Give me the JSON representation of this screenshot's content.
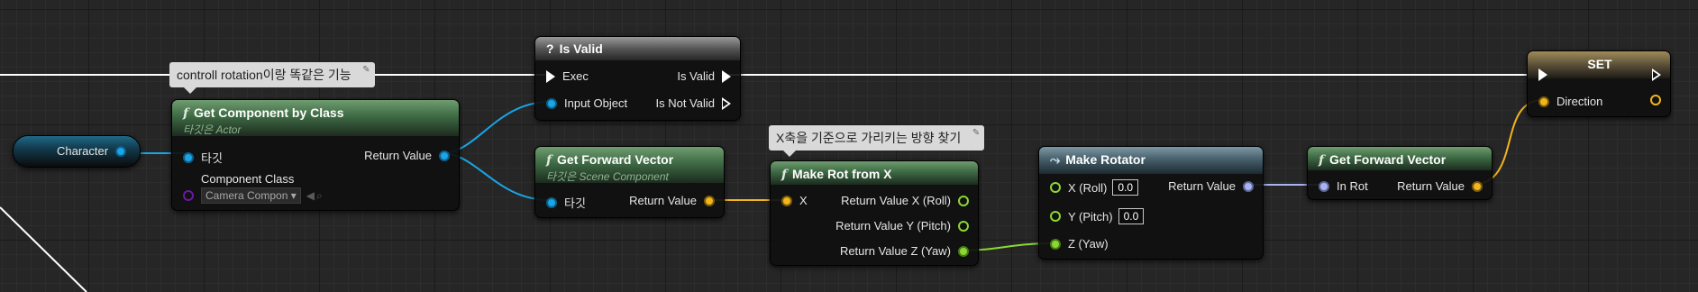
{
  "comments": {
    "c1": "controll rotation이랑 똑같은 기능",
    "c2": "X축을 기준으로 가리키는 방향 찾기"
  },
  "nodes": {
    "character_var": {
      "label": "Character"
    },
    "get_component": {
      "title": "Get Component by Class",
      "subtitle": "타깃은 Actor",
      "target_label": "타깃",
      "return_label": "Return Value",
      "class_label": "Component Class",
      "class_value": "Camera Compon",
      "dropdown_arrow": "▾"
    },
    "is_valid": {
      "title": "Is Valid",
      "icon": "?",
      "exec_label": "Exec",
      "is_valid_label": "Is Valid",
      "input_label": "Input Object",
      "not_valid_label": "Is Not Valid"
    },
    "get_forward_1": {
      "title": "Get Forward Vector",
      "subtitle": "타깃은 Scene Component",
      "target_label": "타깃",
      "return_label": "Return Value"
    },
    "make_rot_x": {
      "title": "Make Rot from X",
      "x_label": "X",
      "rx_label": "Return Value X (Roll)",
      "ry_label": "Return Value Y (Pitch)",
      "rz_label": "Return Value Z (Yaw)"
    },
    "make_rotator": {
      "title": "Make Rotator",
      "roll_label": "X (Roll)",
      "roll_value": "0.0",
      "pitch_label": "Y (Pitch)",
      "pitch_value": "0.0",
      "yaw_label": "Z (Yaw)",
      "return_label": "Return Value"
    },
    "get_forward_2": {
      "title": "Get Forward Vector",
      "in_rot_label": "In Rot",
      "return_label": "Return Value"
    },
    "set_node": {
      "title": "SET",
      "direction_label": "Direction"
    }
  },
  "icons": {
    "function": "f",
    "pin_comment": "✎"
  },
  "colors": {
    "exec_wire": "#ffffff",
    "object_wire": "#1aa5e6",
    "vector_wire": "#f2b51e",
    "float_wire": "#8bd833",
    "rotator_wire": "#a9b3f0",
    "function_header": "#3e6a44"
  }
}
